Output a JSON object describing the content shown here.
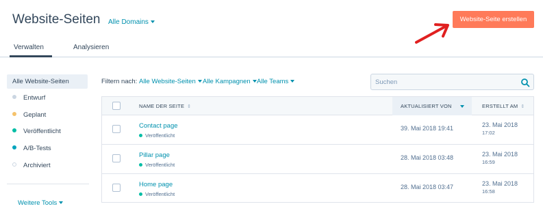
{
  "header": {
    "title": "Website-Seiten",
    "domain_select": "Alle Domains",
    "create_button": "Website-Seite erstellen"
  },
  "tabs": [
    {
      "label": "Verwalten",
      "active": true
    },
    {
      "label": "Analysieren",
      "active": false
    }
  ],
  "sidebar": {
    "items": [
      {
        "label": "Alle Website-Seiten",
        "selected": true,
        "dot_color": ""
      },
      {
        "label": "Entwurf",
        "selected": false,
        "dot_color": "#cbd6e2"
      },
      {
        "label": "Geplant",
        "selected": false,
        "dot_color": "#f5c26b"
      },
      {
        "label": "Veröffentlicht",
        "selected": false,
        "dot_color": "#00bda5"
      },
      {
        "label": "A/B-Tests",
        "selected": false,
        "dot_color": "#00a4bd"
      },
      {
        "label": "Archiviert",
        "selected": false,
        "dot_color": "outline"
      }
    ],
    "more_tools": "Weitere Tools"
  },
  "filters": {
    "label": "Filtern nach:",
    "pages": "Alle Website-Seiten",
    "campaigns": "Alle Kampagnen",
    "teams": "Alle Teams"
  },
  "search": {
    "placeholder": "Suchen",
    "value": ""
  },
  "table": {
    "columns": {
      "name": "NAME DER SEITE",
      "updated": "AKTUALISIERT VON",
      "created": "ERSTELLT AM"
    },
    "sorted_column": "updated",
    "rows": [
      {
        "name": "Contact page",
        "status": "Veröffentlicht",
        "updated": "39. Mai 2018 19:41",
        "created_date": "23. Mai 2018",
        "created_time": "17:02"
      },
      {
        "name": "Pillar page",
        "status": "Veröffentlicht",
        "updated": "28. Mai 2018 03:48",
        "created_date": "23. Mai 2018",
        "created_time": "16:59"
      },
      {
        "name": "Home page",
        "status": "Veröffentlicht",
        "updated": "28. Mai 2018 03:47",
        "created_date": "23. Mai 2018",
        "created_time": "16:58"
      }
    ]
  },
  "colors": {
    "accent": "#ff7a59",
    "link": "#0091ae",
    "text": "#33475b",
    "annotation_arrow": "#e02020"
  }
}
